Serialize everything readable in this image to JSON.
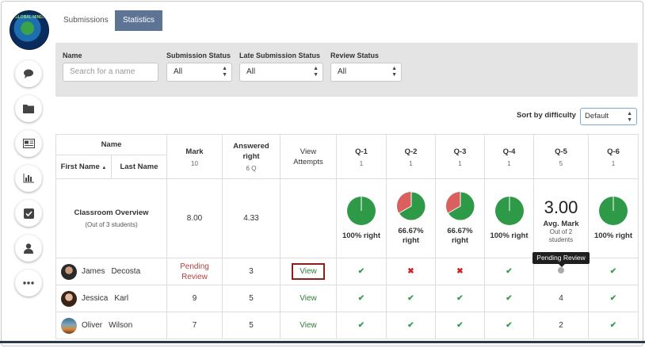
{
  "brand": {
    "logo_text": "GLOBAL MINDS"
  },
  "tabs": [
    {
      "label": "Submissions"
    },
    {
      "label": "Statistics"
    }
  ],
  "filters": {
    "name_label": "Name",
    "name_placeholder": "Search for a name",
    "submission_status_label": "Submission Status",
    "submission_status_value": "All",
    "late_status_label": "Late Submission Status",
    "late_status_value": "All",
    "review_status_label": "Review Status",
    "review_status_value": "All"
  },
  "sort": {
    "label": "Sort by difficulty",
    "value": "Default"
  },
  "table": {
    "name_header": "Name",
    "first_name_header": "First Name",
    "last_name_header": "Last Name",
    "mark_header": "Mark",
    "mark_sub": "10",
    "answered_header": "Answered right",
    "answered_sub": "6 Q",
    "attempts_header": "View Attempts",
    "questions": [
      {
        "label": "Q-1",
        "points": "1"
      },
      {
        "label": "Q-2",
        "points": "1"
      },
      {
        "label": "Q-3",
        "points": "1"
      },
      {
        "label": "Q-4",
        "points": "1"
      },
      {
        "label": "Q-5",
        "points": "5"
      },
      {
        "label": "Q-6",
        "points": "1"
      }
    ],
    "overview": {
      "title": "Classroom Overview",
      "subtitle": "(Out of 3 students)",
      "mark": "8.00",
      "answered": "4.33",
      "q1": "100% right",
      "q2": "66.67% right",
      "q3": "66.67% right",
      "q4": "100% right",
      "q5_value": "3.00",
      "q5_label": "Avg. Mark",
      "q5_sub": "Out of 2 students",
      "q6": "100% right",
      "pie_fractions": [
        1.0,
        0.6667,
        0.6667,
        1.0,
        null,
        1.0
      ]
    },
    "students": [
      {
        "first": "James",
        "last": "Decosta",
        "mark": "Pending Review",
        "answered": "3",
        "view": "View",
        "q5": ""
      },
      {
        "first": "Jessica",
        "last": "Karl",
        "mark": "9",
        "answered": "5",
        "view": "View",
        "q5": "4"
      },
      {
        "first": "Oliver",
        "last": "Wilson",
        "mark": "7",
        "answered": "5",
        "view": "View",
        "q5": "2"
      }
    ]
  },
  "tooltip": "Pending Review",
  "icons": {
    "check": "✔",
    "cross": "✖",
    "sort_up": "▲",
    "select_caret_up": "▲",
    "select_caret_down": "▼"
  },
  "colors": {
    "pie_green": "#2e9a47",
    "pie_red": "#d9605f",
    "tab_active": "#5d7494",
    "pending": "#b0413e"
  }
}
